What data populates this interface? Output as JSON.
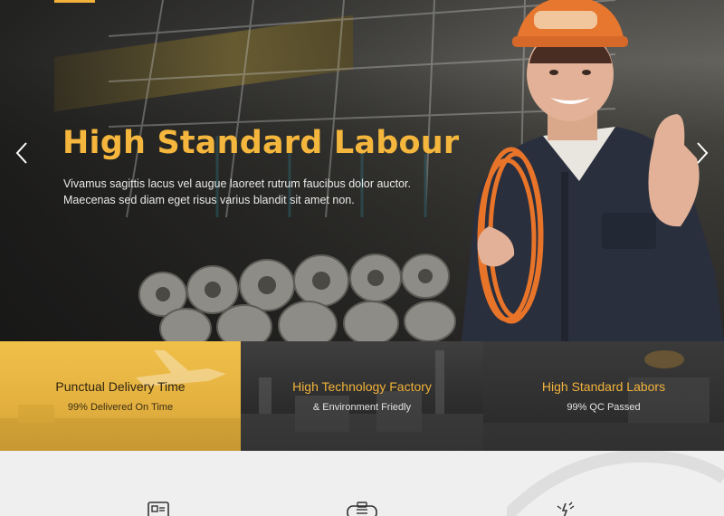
{
  "hero": {
    "title": "High Standard Labour",
    "text_line1": "Vivamus sagittis lacus vel augue laoreet rutrum faucibus dolor auctor.",
    "text_line2": "Maecenas sed diam eget risus varius blandit sit amet non.",
    "prev_icon": "chevron-left-icon",
    "next_icon": "chevron-right-icon"
  },
  "features": [
    {
      "title": "Punctual Delivery Time",
      "subtitle": "99% Delivered On Time"
    },
    {
      "title": "High Technology Factory",
      "subtitle": "& Environment Friedly"
    },
    {
      "title": "High Standard Labors",
      "subtitle": "99% QC Passed"
    }
  ],
  "services": {
    "icons": [
      "monitor-icon",
      "toolbox-icon",
      "spark-icon"
    ]
  },
  "colors": {
    "accent": "#f4b63c",
    "band_yellow": "#e8b540",
    "band_dark": "#2d2d2d"
  }
}
